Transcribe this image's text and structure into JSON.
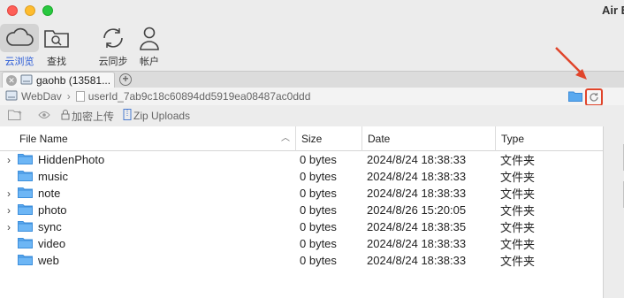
{
  "app": {
    "title": "Air E"
  },
  "toolbar": {
    "cloud_browse": "云浏览",
    "search": "查找",
    "cloud_sync": "云同步",
    "account": "帐户"
  },
  "tabs": [
    {
      "label": "gaohb (13581..."
    }
  ],
  "path": {
    "root": "WebDav",
    "current": "userId_7ab9c18c60894dd5919ea08487ac0ddd"
  },
  "actions": {
    "encrypt_upload": "加密上传",
    "zip_uploads": "Zip Uploads"
  },
  "table": {
    "headers": {
      "name": "File Name",
      "size": "Size",
      "date": "Date",
      "type": "Type"
    },
    "rows": [
      {
        "expandable": true,
        "name": "HiddenPhoto",
        "size": "0 bytes",
        "date": "2024/8/24 18:38:33",
        "type": "文件夹"
      },
      {
        "expandable": false,
        "name": "music",
        "size": "0 bytes",
        "date": "2024/8/24 18:38:33",
        "type": "文件夹"
      },
      {
        "expandable": true,
        "name": "note",
        "size": "0 bytes",
        "date": "2024/8/24 18:38:33",
        "type": "文件夹"
      },
      {
        "expandable": true,
        "name": "photo",
        "size": "0 bytes",
        "date": "2024/8/26 15:20:05",
        "type": "文件夹"
      },
      {
        "expandable": true,
        "name": "sync",
        "size": "0 bytes",
        "date": "2024/8/24 18:38:35",
        "type": "文件夹"
      },
      {
        "expandable": false,
        "name": "video",
        "size": "0 bytes",
        "date": "2024/8/24 18:38:33",
        "type": "文件夹"
      },
      {
        "expandable": false,
        "name": "web",
        "size": "0 bytes",
        "date": "2024/8/24 18:38:33",
        "type": "文件夹"
      }
    ]
  },
  "colors": {
    "accent": "#2a5bd7",
    "folder": "#5aa9ef",
    "annotation": "#e0452b"
  }
}
